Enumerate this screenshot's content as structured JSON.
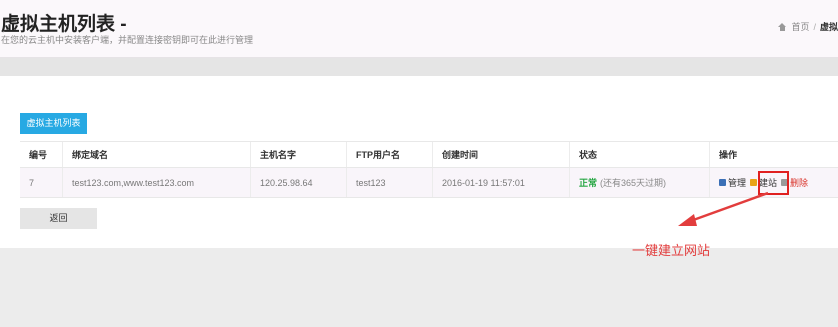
{
  "header": {
    "title": "虚拟主机列表 -",
    "subtitle": "在您的云主机中安装客户端，并配置连接密钥即可在此进行管理",
    "breadcrumb": {
      "home": "首页",
      "separator": "/",
      "current": "虚拟"
    }
  },
  "list_button": "虚拟主机列表",
  "table": {
    "headers": [
      "编号",
      "绑定域名",
      "主机名字",
      "FTP用户名",
      "创建时间",
      "状态",
      "操作"
    ],
    "rows": [
      {
        "id": "7",
        "domains": "test123.com,www.test123.com",
        "host": "120.25.98.64",
        "ftp_user": "test123",
        "created": "2016-01-19 11:57:01",
        "status": "正常",
        "status_note": "(还有365天过期)",
        "actions": {
          "manage": "管理",
          "build": "建站",
          "delete": "删除"
        }
      }
    ]
  },
  "back_button": "返回",
  "annotation": "一键建立网站",
  "colors": {
    "primary": "#27a9e3",
    "ok": "#28a745",
    "danger": "#d9342b",
    "annotation": "#e23d3d"
  }
}
